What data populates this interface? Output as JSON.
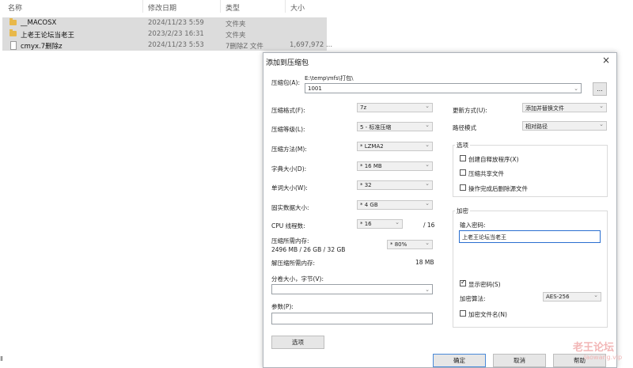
{
  "explorer": {
    "columns": [
      "名称",
      "修改日期",
      "类型",
      "大小"
    ],
    "rows": [
      {
        "icon": "folder-icon",
        "name": "__MACOSX",
        "date": "2024/11/23 5:59",
        "type": "文件夹",
        "size": ""
      },
      {
        "icon": "folder-icon",
        "name": "上老王论坛当老王",
        "date": "2023/2/23 16:31",
        "type": "文件夹",
        "size": ""
      },
      {
        "icon": "file-icon",
        "name": "cmyx.7删除z",
        "date": "2024/11/23 5:53",
        "type": "7删除Z 文件",
        "size": "1,697,972 ..."
      }
    ],
    "fragment_left": "Ⅱ"
  },
  "dialog": {
    "title": "添加到压缩包",
    "close": "×",
    "archive": {
      "label": "压缩包(A):",
      "path": "E:\\temp\\mfs\\打包\\",
      "value": "1001",
      "browse": "..."
    },
    "left": [
      {
        "label": "压缩格式(F):",
        "value": "7z"
      },
      {
        "label": "压缩等级(L):",
        "value": "5 - 标准压缩"
      },
      {
        "label": "压缩方法(M):",
        "value": "* LZMA2"
      },
      {
        "label": "字典大小(D):",
        "value": "* 16 MB"
      },
      {
        "label": "单词大小(W):",
        "value": "* 32"
      },
      {
        "label": "固实数据大小:",
        "value": "* 4 GB"
      }
    ],
    "cpu": {
      "label": "CPU 线程数:",
      "value": "* 16",
      "max": "/ 16"
    },
    "memory": {
      "label": "压缩所需内存:",
      "detail": "2496 MB / 26 GB / 32 GB",
      "value": "* 80%"
    },
    "decompress": {
      "label": "解压缩所需内存:",
      "value": "18 MB"
    },
    "split": {
      "label": "分卷大小，字节(V):",
      "value": ""
    },
    "params": {
      "label": "参数(P):",
      "value": ""
    },
    "options_button": "选项",
    "update": {
      "label": "更新方式(U):",
      "value": "添加并替换文件"
    },
    "pathmode": {
      "label": "路径模式",
      "value": "相对路径"
    },
    "options": {
      "title": "选项",
      "items": [
        {
          "label": "创建自释放程序(X)",
          "checked": false
        },
        {
          "label": "压缩共享文件",
          "checked": false
        },
        {
          "label": "操作完成后删除源文件",
          "checked": false
        }
      ]
    },
    "encryption": {
      "title": "加密",
      "password_label": "输入密码:",
      "password_value": "上老王论坛当老王",
      "show_password": {
        "label": "显示密码(S)",
        "checked": true
      },
      "method_label": "加密算法:",
      "method_value": "AES-256",
      "encrypt_names": {
        "label": "加密文件名(N)",
        "checked": false
      }
    },
    "buttons": {
      "ok": "确定",
      "cancel": "取消",
      "help": "帮助"
    }
  },
  "watermark": {
    "main": "老王论坛",
    "sub": "laowang.vip"
  }
}
